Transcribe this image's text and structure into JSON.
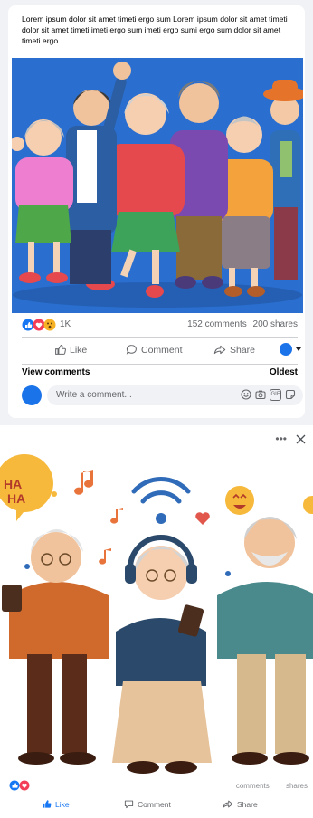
{
  "post1": {
    "caption": "Lorem ipsum dolor sit amet timeti ergo sum Lorem ipsum dolor sit amet timeti dolor sit amet timeti imeti ergo sum imeti ergo sumi ergo sum  dolor sit amet timeti ergo",
    "reaction_count": "1K",
    "comments": "152 comments",
    "shares": "200 shares",
    "actions": {
      "like": "Like",
      "comment": "Comment",
      "share": "Share"
    },
    "view_comments": "View comments",
    "sort": "Oldest",
    "comment_placeholder": "Write a comment...",
    "comment_icons": [
      "smiley-icon",
      "camera-icon",
      "gif-icon",
      "sticker-icon"
    ],
    "gif_label": "GIF"
  },
  "post2": {
    "bubble_text": "HA HA",
    "comments": "comments",
    "shares": "shares",
    "actions": {
      "like": "Like",
      "comment": "Comment",
      "share": "Share"
    }
  },
  "colors": {
    "brand_blue": "#1877f2",
    "photo_bg": "#2a6fd0",
    "love_red": "#f33e58",
    "haha_yellow": "#f7b125"
  }
}
